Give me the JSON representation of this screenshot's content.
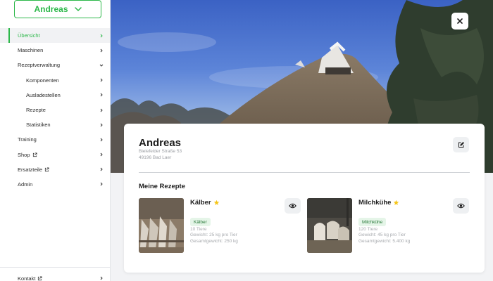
{
  "user_select": {
    "label": "Andreas",
    "icon": "chevron-down-icon"
  },
  "sidebar": {
    "items": [
      {
        "label": "Übersicht",
        "active": true,
        "external": false,
        "sub": false,
        "chevron": "right"
      },
      {
        "label": "Maschinen",
        "active": false,
        "external": false,
        "sub": false,
        "chevron": "right"
      },
      {
        "label": "Rezeptverwaltung",
        "active": false,
        "external": false,
        "sub": false,
        "chevron": "down"
      },
      {
        "label": "Komponenten",
        "active": false,
        "external": false,
        "sub": true,
        "chevron": "right"
      },
      {
        "label": "Ausladestellen",
        "active": false,
        "external": false,
        "sub": true,
        "chevron": "right"
      },
      {
        "label": "Rezepte",
        "active": false,
        "external": false,
        "sub": true,
        "chevron": "right"
      },
      {
        "label": "Statistiken",
        "active": false,
        "external": false,
        "sub": true,
        "chevron": "right"
      },
      {
        "label": "Training",
        "active": false,
        "external": false,
        "sub": false,
        "chevron": "right"
      },
      {
        "label": "Shop",
        "active": false,
        "external": true,
        "sub": false,
        "chevron": "right"
      },
      {
        "label": "Ersatzteile",
        "active": false,
        "external": true,
        "sub": false,
        "chevron": "right"
      },
      {
        "label": "Admin",
        "active": false,
        "external": false,
        "sub": false,
        "chevron": "right"
      }
    ],
    "bottom": {
      "label": "Kontakt",
      "external": true
    }
  },
  "hero": {
    "close_icon": "close-icon"
  },
  "farm": {
    "name": "Andreas",
    "street": "Bielefelder Straße 53",
    "city": "49196 Bad Laer",
    "edit_icon": "edit-icon"
  },
  "recipes_section": {
    "title": "Meine Rezepte",
    "recipes": [
      {
        "name": "Kälber",
        "favorite": true,
        "badge": "Kälber",
        "animals": "10 Tiere",
        "weight_per_animal": "Gewicht: 25 kg pro Tier",
        "total_weight": "Gesamtgewicht: 250 kg"
      },
      {
        "name": "Milchkühe",
        "favorite": true,
        "badge": "Milchkühe",
        "animals": "120 Tiere",
        "weight_per_animal": "Gewicht: 45 kg pro Tier",
        "total_weight": "Gesamtgewicht: 5.400 kg"
      }
    ]
  },
  "colors": {
    "accent": "#2db84a",
    "star": "#f5c518",
    "badge_bg": "#e5f5e8",
    "muted_text": "#a7aaae"
  }
}
